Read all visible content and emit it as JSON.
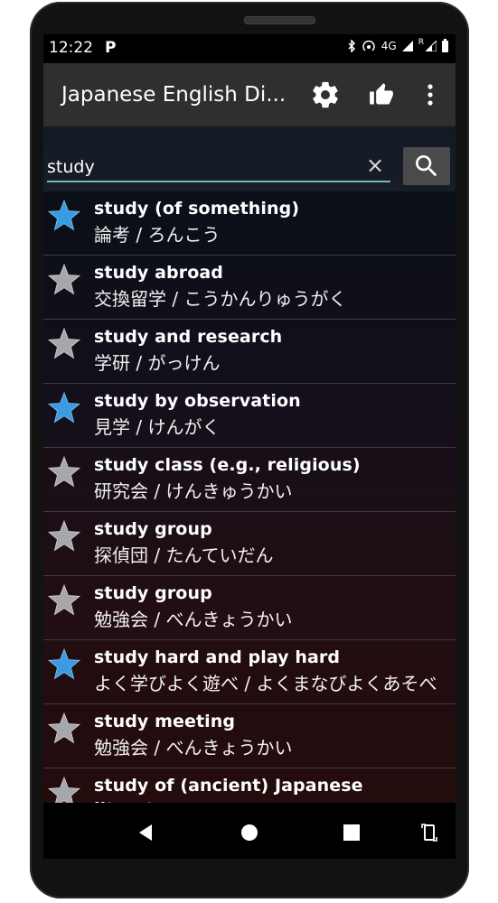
{
  "status_bar": {
    "time": "12:22",
    "network": "4G",
    "roaming": "R"
  },
  "app_bar": {
    "title": "Japanese English Di...",
    "icons": [
      "settings-icon",
      "thumbs-up-icon",
      "overflow-menu-icon"
    ]
  },
  "search": {
    "value": "study",
    "placeholder": "",
    "clear_symbol": "×"
  },
  "entries": [
    {
      "en": "study (of something)",
      "jp": "論考 / ろんこう",
      "favorite": true
    },
    {
      "en": "study abroad",
      "jp": "交換留学 / こうかんりゅうがく",
      "favorite": false
    },
    {
      "en": "study and research",
      "jp": "学研 / がっけん",
      "favorite": false
    },
    {
      "en": "study by observation",
      "jp": "見学 / けんがく",
      "favorite": true
    },
    {
      "en": "study class (e.g., religious)",
      "jp": "研究会 / けんきゅうかい",
      "favorite": false
    },
    {
      "en": "study group",
      "jp": "探偵団 / たんていだん",
      "favorite": false
    },
    {
      "en": "study group",
      "jp": "勉強会 / べんきょうかい",
      "favorite": false
    },
    {
      "en": "study hard and play hard",
      "jp": "よく学びよく遊べ / よくまなびよくあそべ",
      "favorite": true
    },
    {
      "en": "study meeting",
      "jp": "勉強会 / べんきょうかい",
      "favorite": false
    },
    {
      "en": "study of (ancient) Japanese literature",
      "jp": "",
      "favorite": false
    }
  ],
  "colors": {
    "star_favorite": "#3a9be0",
    "star_normal": "#a7a7ab",
    "accent_underline": "#74b8bd",
    "app_bar": "#2f2f2f"
  }
}
